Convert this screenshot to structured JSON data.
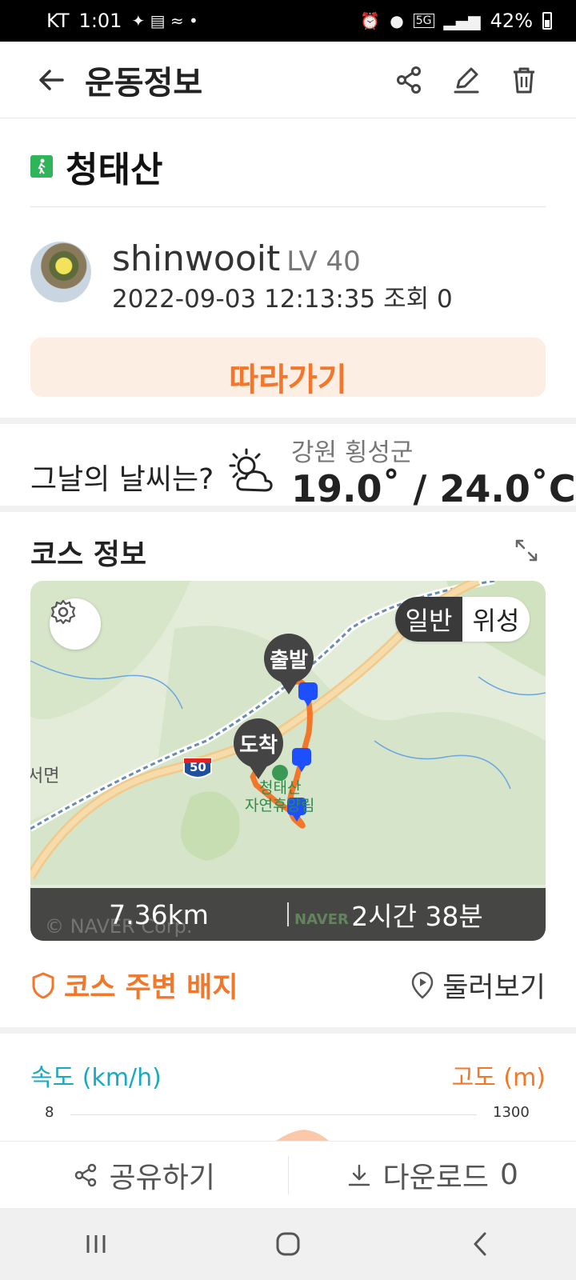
{
  "status_bar": {
    "carrier": "KT",
    "time": "1:01",
    "battery": "42%",
    "network": "5G"
  },
  "header": {
    "title": "운동정보"
  },
  "course": {
    "name": "청태산"
  },
  "user": {
    "name": "shinwooit",
    "level": "LV 40",
    "date": "2022-09-03 12:13:35",
    "views_label": "조회",
    "views": "0"
  },
  "follow_button": {
    "label": "따라가기"
  },
  "weather": {
    "question": "그날의 날씨는?",
    "location": "강원 횡성군",
    "temperature": "19.0˚ / 24.0˚C"
  },
  "course_info": {
    "title": "코스 정보"
  },
  "map": {
    "mode_normal": "일반",
    "mode_satellite": "위성",
    "start_label": "출발",
    "end_label": "도착",
    "highway_number": "50",
    "place_label_1": "청태산",
    "place_label_2": "자연휴양림",
    "town_label": "서면",
    "distance": "7.36km",
    "duration": "2시간 38분",
    "copyright": "© NAVER Corp.",
    "logo": "NAVER"
  },
  "badges": {
    "label": "코스 주변 배지"
  },
  "tour": {
    "label": "둘러보기"
  },
  "graph": {
    "speed_label": "속도 (km/h)",
    "altitude_label": "고도 (m)",
    "speed_max": "8",
    "altitude_max": "1300"
  },
  "bottom_bar": {
    "share_label": "공유하기",
    "download_label": "다운로드",
    "download_count": "0"
  },
  "colors": {
    "accent": "#f2772b",
    "teal": "#1aa9bf",
    "route": "#f2772b",
    "checkpoint": "#1d4fff"
  }
}
